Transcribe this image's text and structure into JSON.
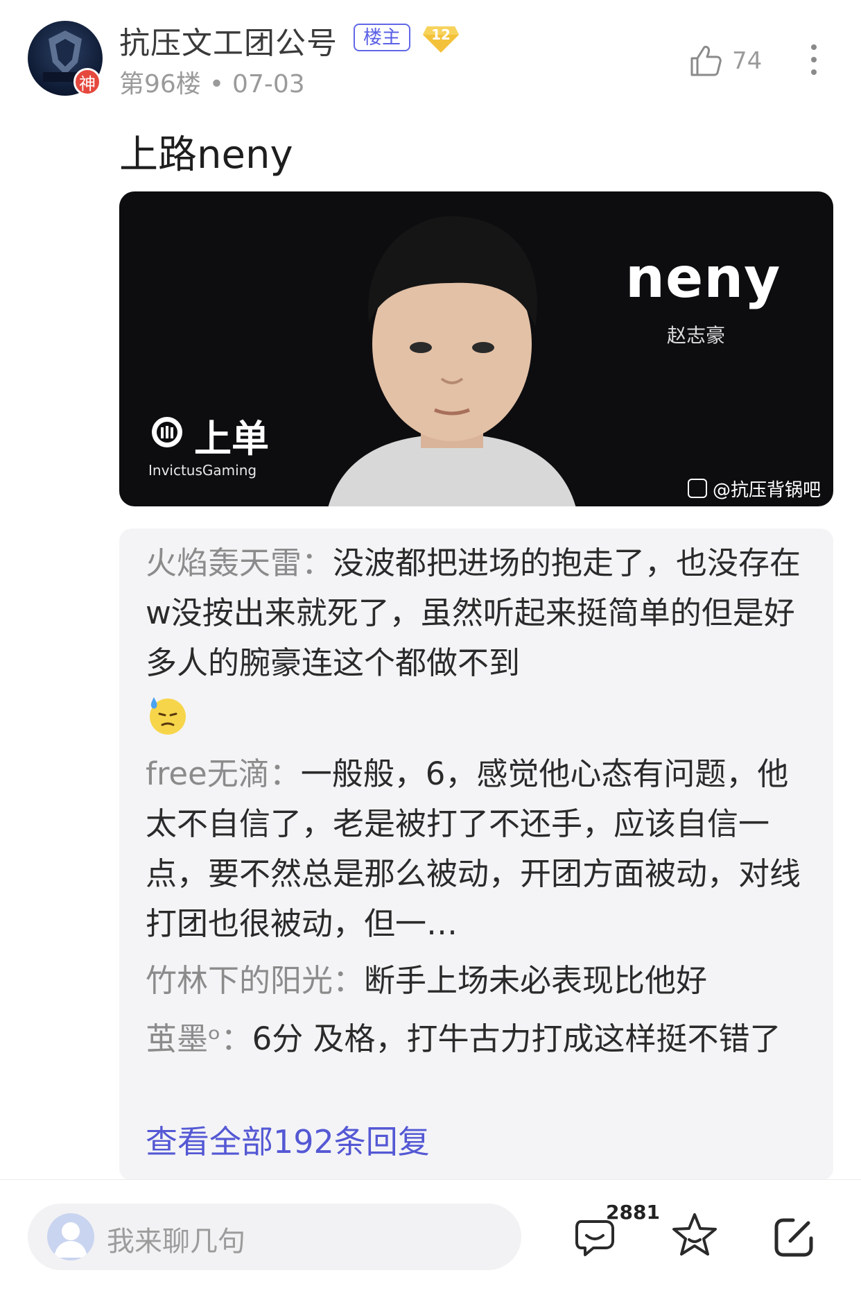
{
  "header": {
    "username": "抗压文工团公号",
    "owner_tag": "楼主",
    "level": "12",
    "avatar_badge": "神",
    "floor": "第96楼",
    "separator": "•",
    "date": "07-03",
    "like_count": "74"
  },
  "post": {
    "text": "上路neny",
    "image": {
      "name": "neny",
      "cn_name": "赵志豪",
      "role": "上单",
      "team": "InvictusGaming",
      "watermark": "@抗压背锅吧"
    }
  },
  "replies": [
    {
      "user": "火焰轰天雷：",
      "text": "没波都把进场的抱走了，也没存在w没按出来就死了，虽然听起来挺简单的但是好多人的腕豪连这个都做不到"
    },
    {
      "user": "free无滴：",
      "text": "一般般，6，感觉他心态有问题，他太不自信了，老是被打了不还手，应该自信一点，要不然总是那么被动，开团方面被动，对线打团也很被动，但一…"
    },
    {
      "user": "竹林下的阳光：",
      "text": "断手上场未必表现比他好"
    },
    {
      "user": "茧墨ᵒ：",
      "text": "6分 及格，打牛古力打成这样挺不错了"
    }
  ],
  "view_all": "查看全部192条回复",
  "bottom": {
    "placeholder": "我来聊几句",
    "comment_count": "2881"
  },
  "colors": {
    "accent": "#5458d4",
    "reply_bg": "#f4f4f6",
    "badge_gold": "#f3c23a",
    "badge_red": "#e5483d"
  },
  "icons": [
    "like-icon",
    "more-icon",
    "emoji-sweat-icon",
    "comment-icon",
    "star-icon",
    "edit-icon"
  ]
}
